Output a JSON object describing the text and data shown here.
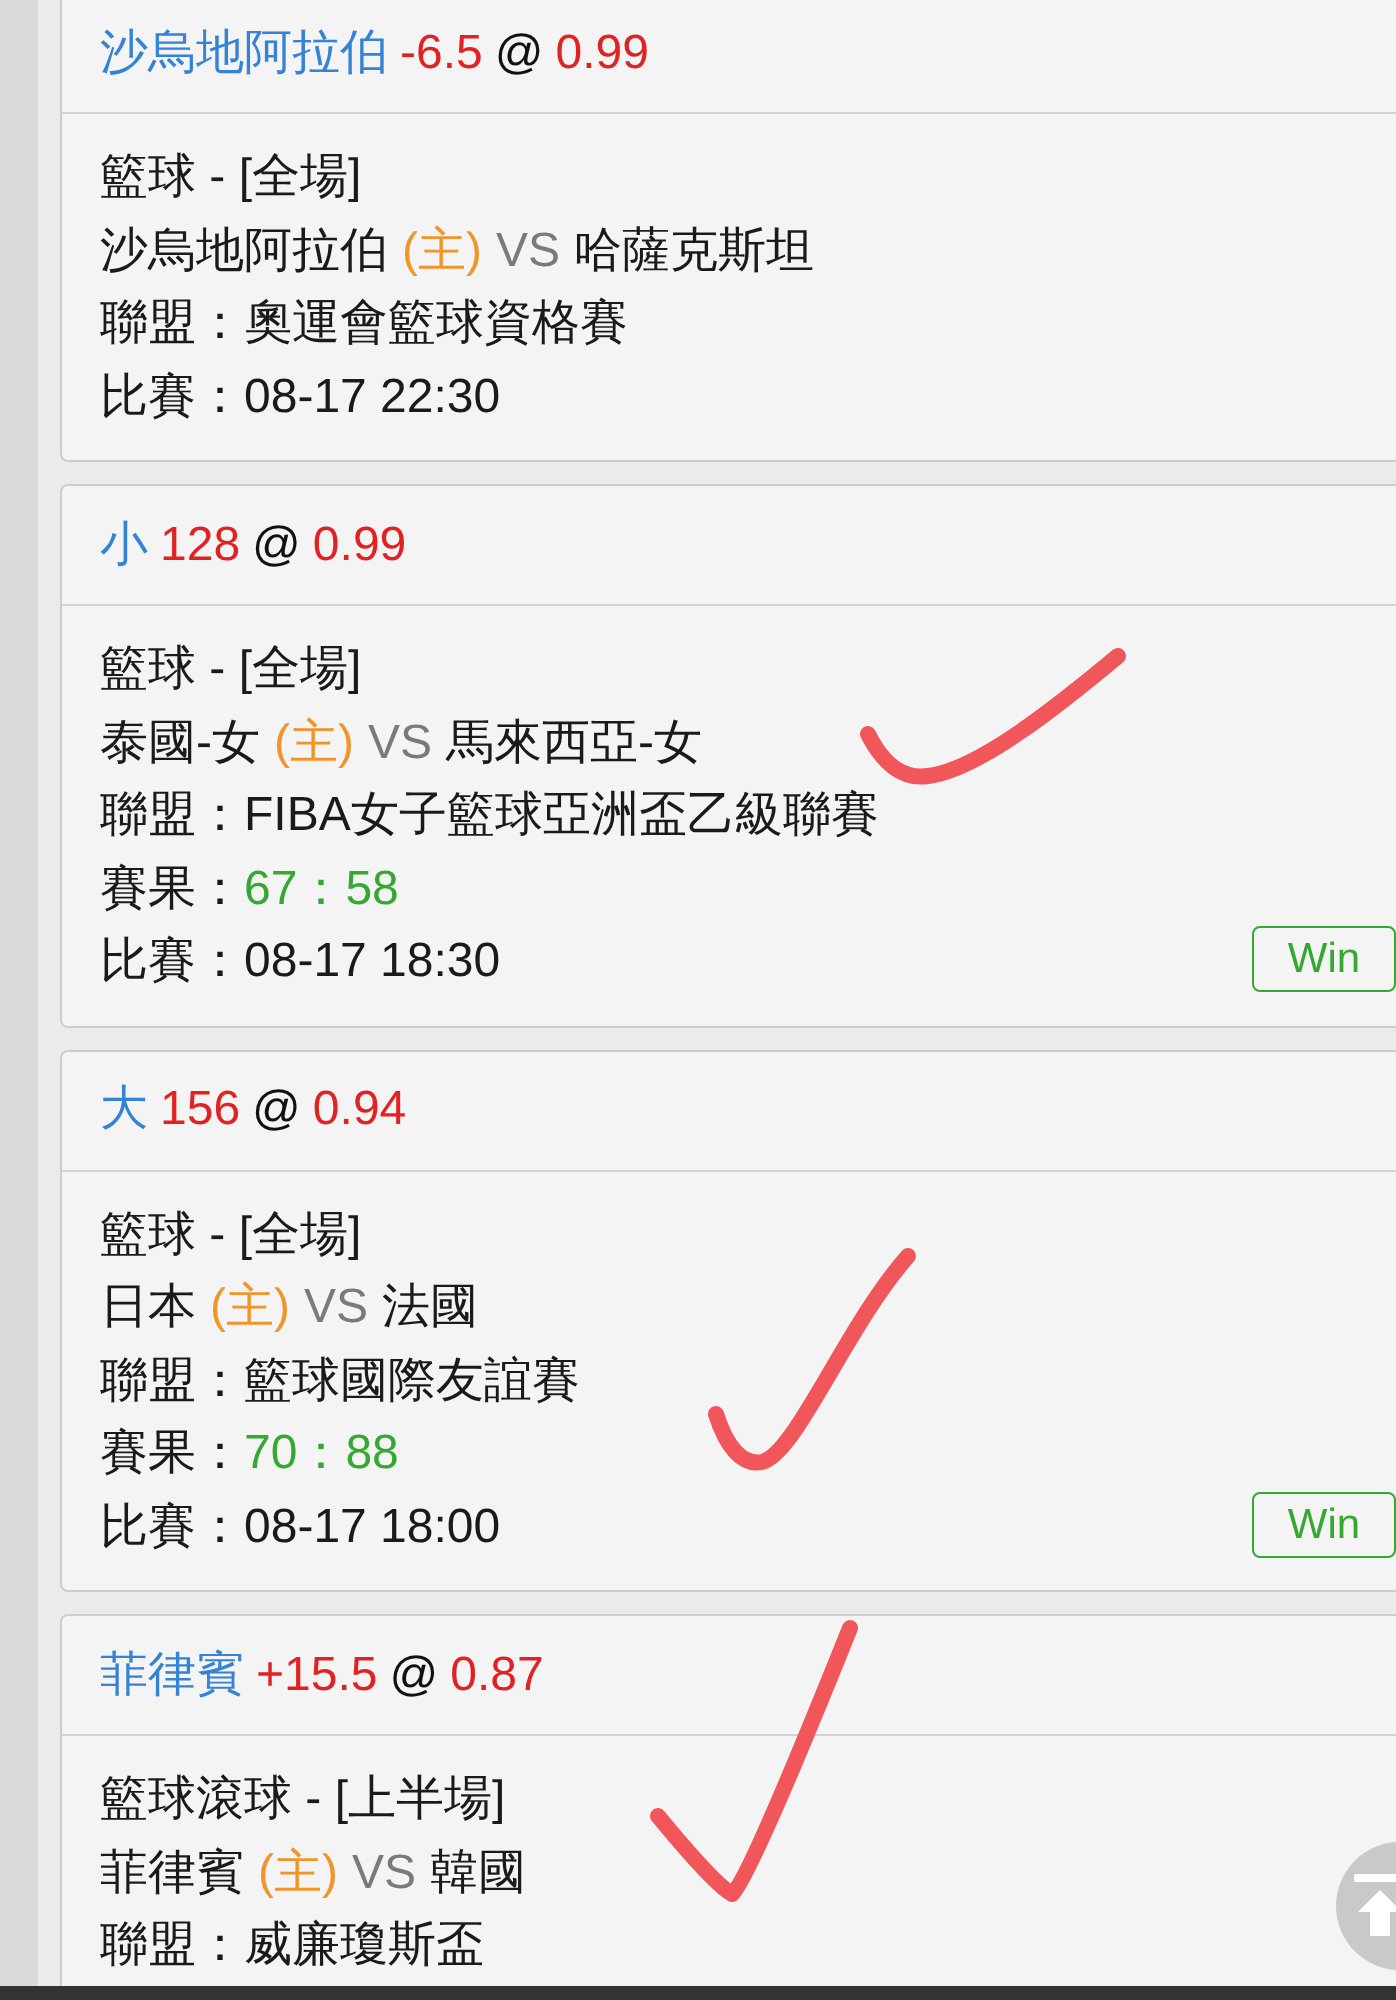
{
  "cards": [
    {
      "header": {
        "selection": "沙烏地阿拉伯",
        "line": "-6.5",
        "at": "@",
        "odds": "0.99"
      },
      "sport": "籃球 - [全場]",
      "home": "沙烏地阿拉伯",
      "home_tag": "(主)",
      "vs": "VS",
      "away": "哈薩克斯坦",
      "league": "聯盟：奧運會籃球資格賽",
      "match": "比賽：08-17 22:30",
      "marked": false
    },
    {
      "header": {
        "selection": "小",
        "line": "128",
        "at": "@",
        "odds": "0.99"
      },
      "sport": "籃球 - [全場]",
      "home": "泰國-女",
      "home_tag": "(主)",
      "vs": "VS",
      "away": "馬來西亞-女",
      "league": "聯盟：FIBA女子籃球亞洲盃乙級聯賽",
      "result": {
        "label": "賽果：",
        "score": "67：58"
      },
      "match": "比賽：08-17 18:30",
      "badge": "Win",
      "marked": true
    },
    {
      "header": {
        "selection": "大",
        "line": "156",
        "at": "@",
        "odds": "0.94"
      },
      "sport": "籃球 - [全場]",
      "home": "日本",
      "home_tag": "(主)",
      "vs": "VS",
      "away": "法國",
      "league": "聯盟：籃球國際友誼賽",
      "result": {
        "label": "賽果：",
        "score": "70：88"
      },
      "match": "比賽：08-17 18:00",
      "badge": "Win",
      "marked": true
    },
    {
      "header": {
        "selection": "菲律賓",
        "line": "+15.5",
        "at": "@",
        "odds": "0.87"
      },
      "sport": "籃球滾球 - [上半場]",
      "home": "菲律賓",
      "home_tag": "(主)",
      "vs": "VS",
      "away": "韓國",
      "league": "聯盟：威廉瓊斯盃",
      "marked": true
    }
  ]
}
